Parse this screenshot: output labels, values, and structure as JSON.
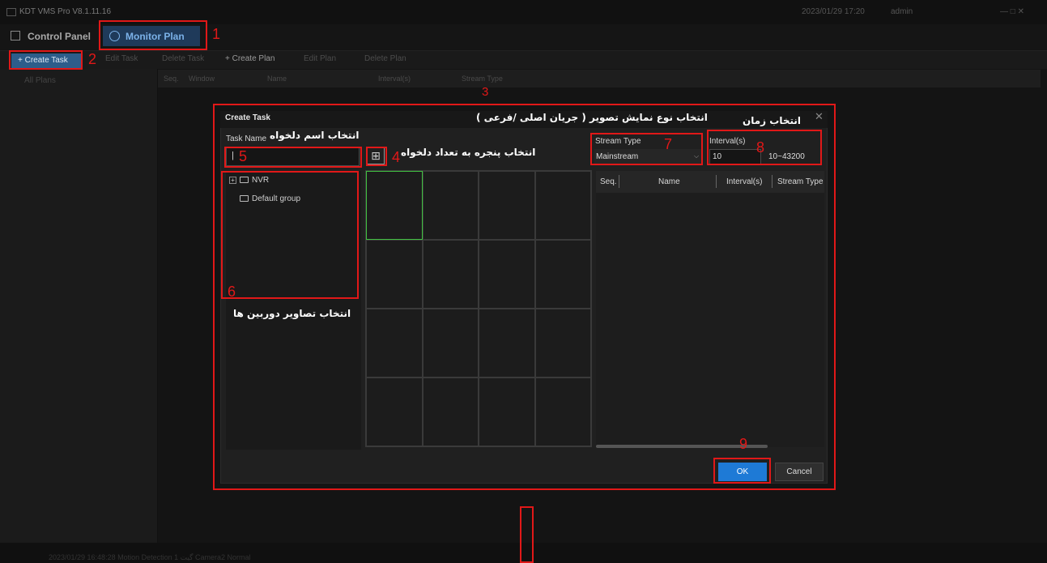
{
  "titlebar": {
    "title": "KDT VMS Pro V8.1.11.16",
    "datetime": "2023/01/29 17:20",
    "user": "admin"
  },
  "nav": {
    "control_panel": "Control Panel",
    "monitor_plan": "Monitor Plan"
  },
  "toolbar": {
    "create_task": "+ Create Task",
    "edit_task": "Edit Task",
    "delete_task": "Delete Task",
    "create_plan": "+ Create Plan",
    "edit_plan": "Edit Plan",
    "delete_plan": "Delete Plan"
  },
  "sidebar": {
    "item": "All Plans"
  },
  "columns": [
    "Seq.",
    "Window",
    "Name",
    "Interval(s)",
    "Stream Type"
  ],
  "statusbar": {
    "text": "2023/01/29 16:48:28   Motion Detection   1 گیت Camera2   Normal"
  },
  "dialog": {
    "title": "Create Task",
    "task_name_label": "Task Name",
    "task_name_value": "|",
    "grid_icon": "⊞",
    "tree": {
      "root": "NVR",
      "child": "Default group",
      "expander": "+"
    },
    "stream_type_label": "Stream Type",
    "stream_type_value": "Mainstream",
    "stream_arrow": "⌵",
    "interval_label": "Interval(s)",
    "interval_value": "10",
    "interval_range": "10~43200",
    "table_headers": [
      "Seq.",
      "Name",
      "Interval(s)",
      "Stream Type"
    ],
    "ok": "OK",
    "cancel": "Cancel",
    "close": "✕"
  },
  "annotations": {
    "n1": "1",
    "n2": "2",
    "n3": "3",
    "n4": "4",
    "n5": "5",
    "n6": "6",
    "n7": "7",
    "n8": "8",
    "n9": "9",
    "fa_stream": "انتخاب نوع نمایش تصویر ( جریان اصلی /فرعی )",
    "fa_time": "انتخاب زمان",
    "fa_name": "انتخاب اسم دلخواه",
    "fa_window": "انتخاب پنجره به تعداد دلخواه",
    "fa_cameras": "انتخاب تصاویر دوربین ها"
  },
  "colors": {
    "accent": "#1e7ad6",
    "annotation": "#e11818",
    "selected_cell": "#41c141"
  }
}
